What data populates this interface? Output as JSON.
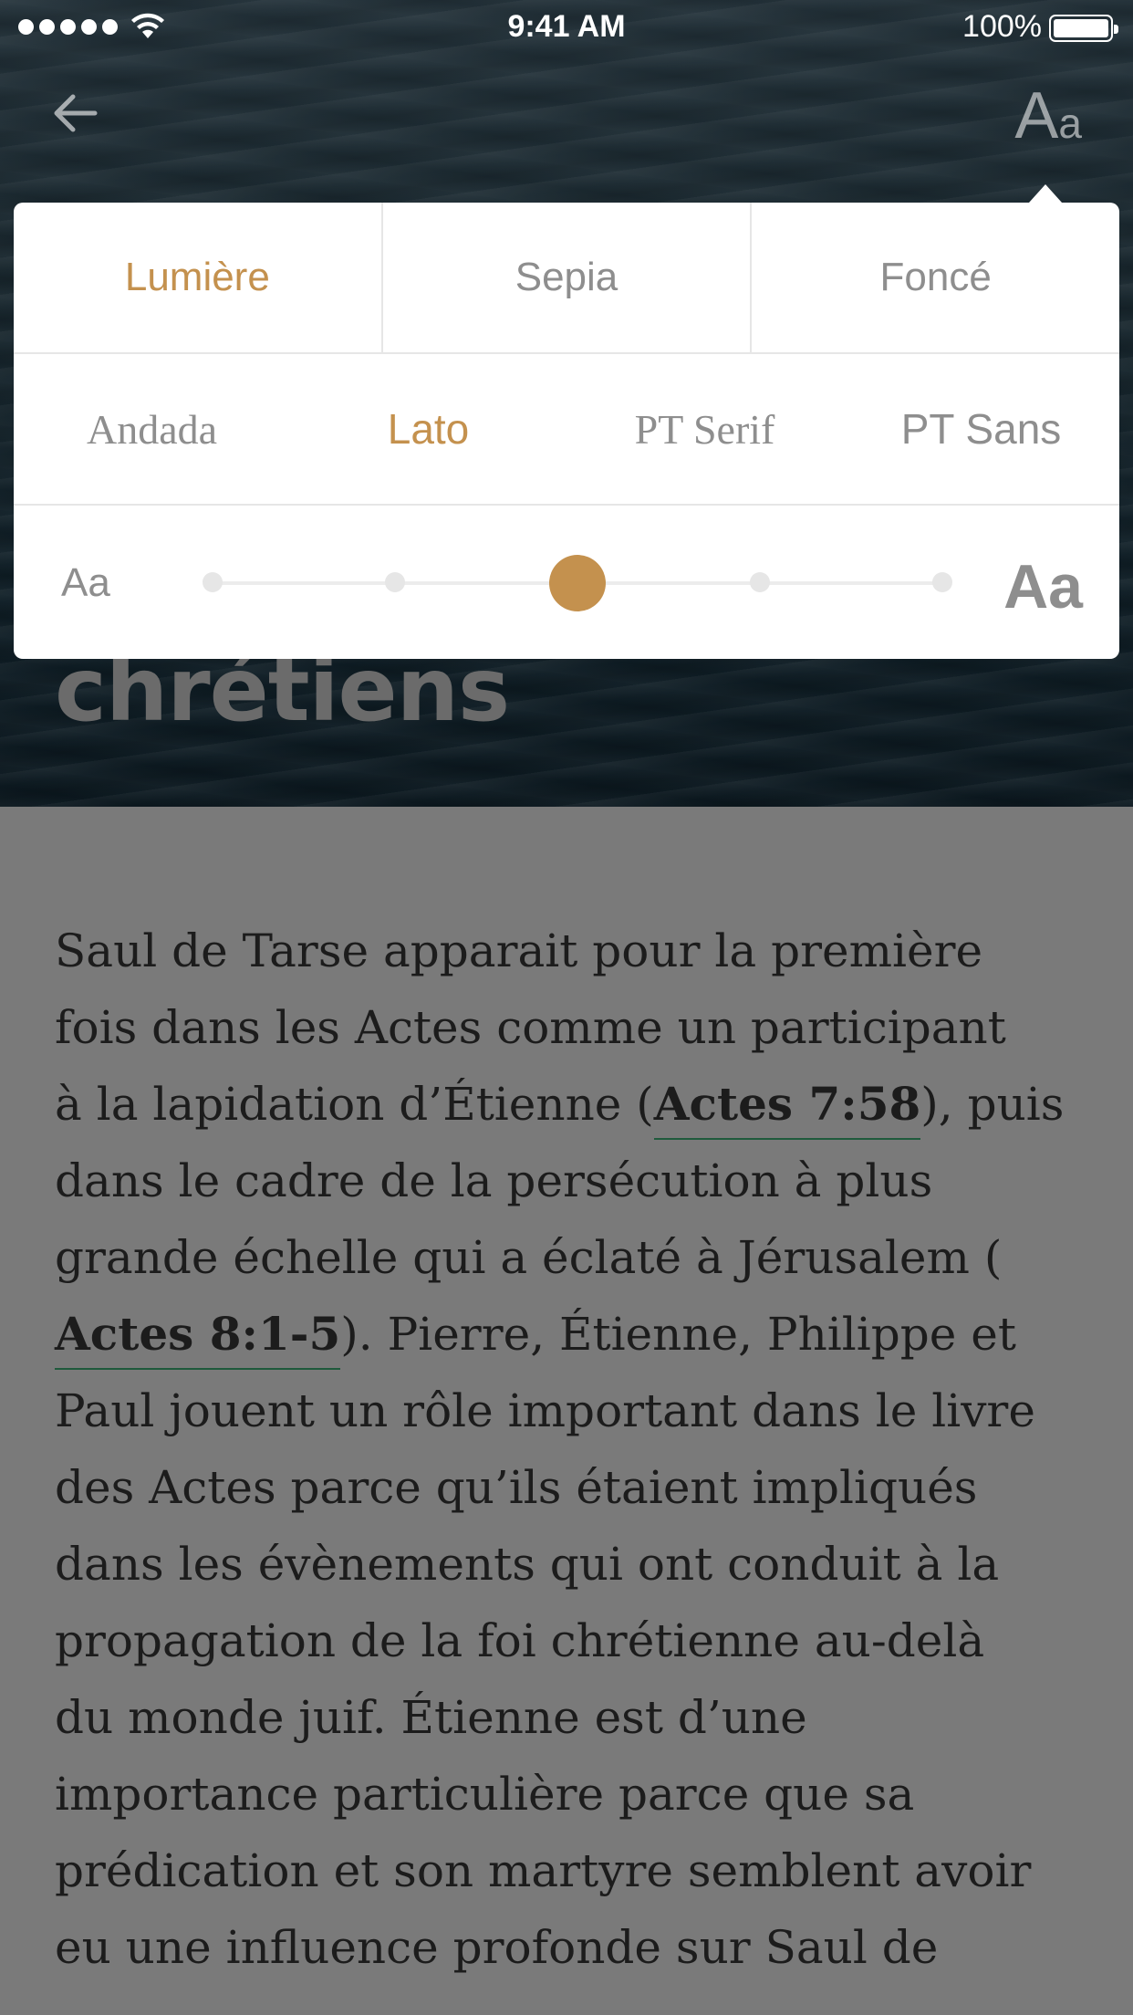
{
  "status_bar": {
    "time": "9:41 AM",
    "battery_percent": "100%",
    "signal_bars": 5
  },
  "nav": {
    "back_icon": "arrow-left-icon",
    "typography_label_big": "A",
    "typography_label_small": "a"
  },
  "article": {
    "title_visible": "chrétiens",
    "paragraph_lines": [
      [
        "Saul de Tarse apparait pour la première"
      ],
      [
        "fois dans les Actes comme un participant"
      ],
      [
        "à la lapidation d’Étienne (",
        {
          "ref": "Actes 7:58"
        },
        "), puis"
      ],
      [
        "dans le cadre de la persécution à plus"
      ],
      [
        "grande échelle qui a éclaté à Jérusalem ("
      ],
      [
        {
          "ref": "Actes 8:1-5"
        },
        "). Pierre, Étienne, Philippe et"
      ],
      [
        "Paul jouent un rôle important dans le livre"
      ],
      [
        "des Actes parce qu’ils étaient impliqués"
      ],
      [
        "dans les évènements qui ont conduit à la"
      ],
      [
        "propagation de la foi chrétienne au-delà"
      ],
      [
        "du monde juif. Étienne est d’une"
      ],
      [
        "importance particulière parce que sa"
      ],
      [
        "prédication et son martyre semblent avoir"
      ],
      [
        "eu une influence profonde sur Saul de"
      ]
    ]
  },
  "settings_popover": {
    "themes": [
      {
        "label": "Lumière",
        "active": true
      },
      {
        "label": "Sepia",
        "active": false
      },
      {
        "label": "Foncé",
        "active": false
      }
    ],
    "fonts": [
      {
        "label": "Andada",
        "active": false
      },
      {
        "label": "Lato",
        "active": true
      },
      {
        "label": "PT Serif",
        "active": false
      },
      {
        "label": "PT Sans",
        "active": false
      }
    ],
    "text_size": {
      "small_label": "Aa",
      "large_label": "Aa",
      "steps": 5,
      "selected_step": 3
    }
  },
  "colors": {
    "accent": "#c4914e",
    "inactive_text": "#8e8e8e",
    "link_underline": "#1f5a3c",
    "overlay_background": "#7a7a7a"
  }
}
